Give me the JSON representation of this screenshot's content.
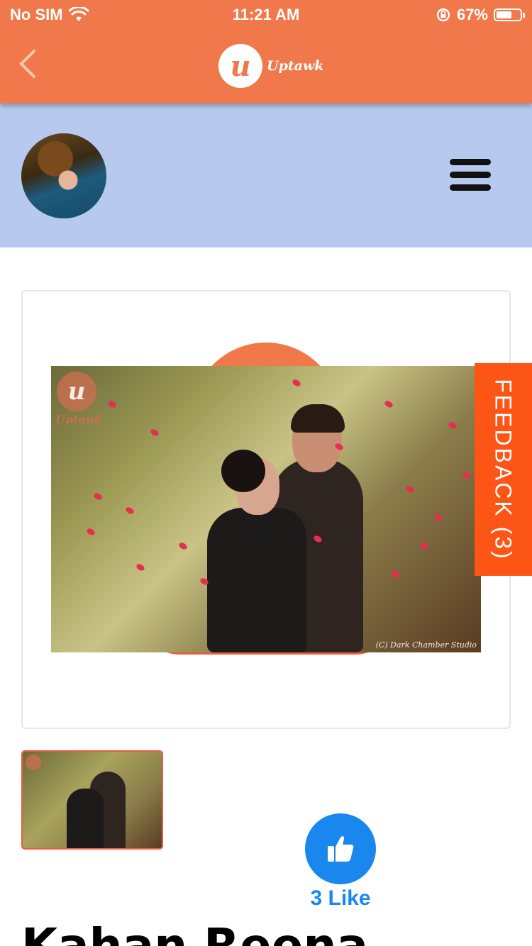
{
  "status_bar": {
    "carrier": "No SIM",
    "time": "11:21 AM",
    "battery_percent": "67%",
    "battery_level": 0.67
  },
  "header": {
    "back_icon": "chevron-left-icon",
    "logo_letter": "u",
    "logo_text": "Uptawk"
  },
  "profile": {
    "avatar_icon": "avatar",
    "menu_icon": "hamburger-menu-icon"
  },
  "post": {
    "photo_watermark_letter": "u",
    "photo_watermark_text": "Uptawk",
    "photo_credit": "(C) Dark Chamber Studio",
    "likes_label": "3 Like",
    "title": "Kahan Reena"
  },
  "feedback": {
    "label": "FEEDBACK (3)"
  },
  "colors": {
    "brand_orange": "#f1784a",
    "feedback_orange": "#fc5516",
    "profile_band": "#b7c9ef",
    "like_blue": "#1a87ee"
  }
}
